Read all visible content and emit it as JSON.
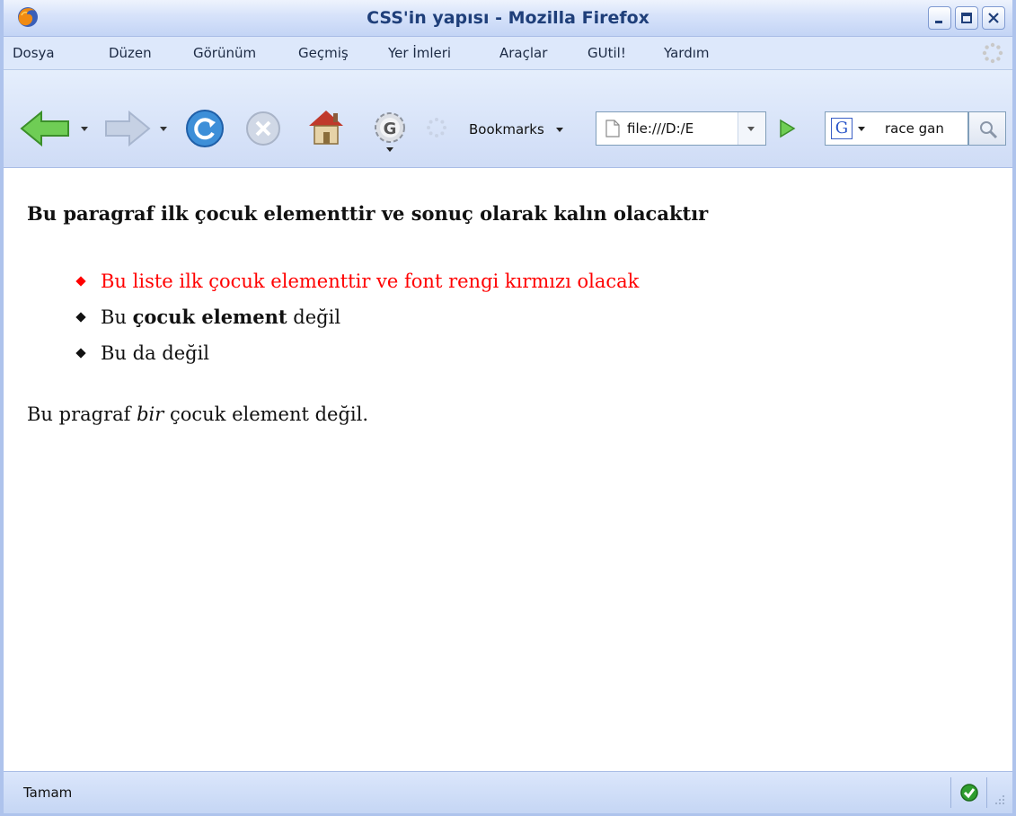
{
  "window": {
    "title": "CSS'in yapısı - Mozilla Firefox"
  },
  "menu": {
    "items": [
      "Dosya",
      "Düzen",
      "Görünüm",
      "Geçmiş",
      "Yer İmleri",
      "Araçlar",
      "GUtil!",
      "Yardım"
    ]
  },
  "toolbar": {
    "bookmarks_label": "Bookmarks",
    "url": "file:///D:/E",
    "search_text": "race gan"
  },
  "content": {
    "p1": "Bu paragraf ilk çocuk elementtir ve sonuç olarak kalın olacaktır",
    "li1": "Bu liste ilk çocuk elementtir ve font rengi kırmızı olacak",
    "li2_a": "Bu ",
    "li2_b": "çocuk element",
    "li2_c": " değil",
    "li3": "Bu da değil",
    "p2_a": "Bu pragraf ",
    "p2_b": "bir",
    "p2_c": " çocuk element değil."
  },
  "status": {
    "text": "Tamam"
  },
  "colors": {
    "list_first_item": "#ff0000",
    "chrome_blue": "#cfdcf6"
  }
}
